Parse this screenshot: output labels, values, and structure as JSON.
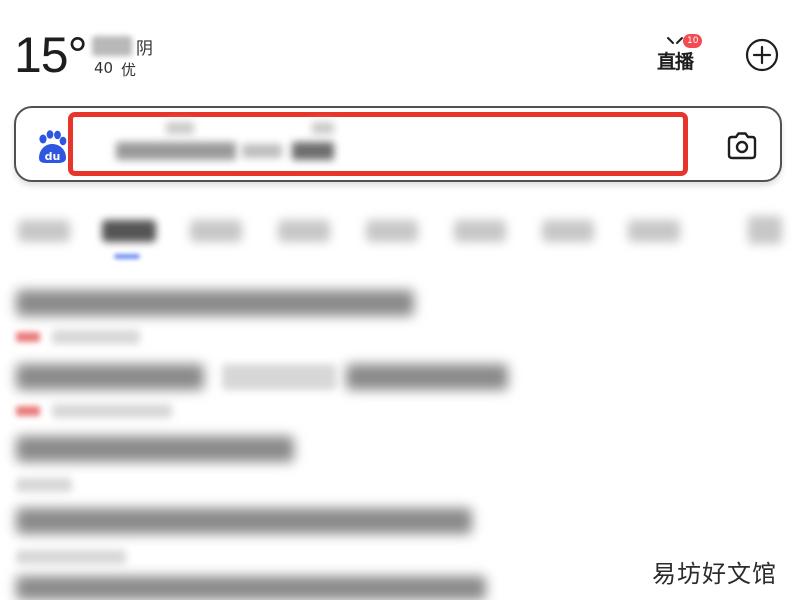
{
  "header": {
    "temperature": "15°",
    "weather": "阴",
    "aqi_value": "40",
    "aqi_level": "优",
    "live_label": "直播",
    "live_badge": "10"
  },
  "search": {
    "placeholder": ""
  },
  "colors": {
    "highlight_border": "#e8352b",
    "baidu_blue": "#2f56e0",
    "live_badge": "#f44a52",
    "tab_indicator": "#6f8ff2"
  },
  "icons": {
    "logo": "baidu-paw-logo",
    "add": "plus-circle-icon",
    "camera": "camera-icon",
    "live": "tv-live-icon"
  },
  "watermark": "易坊好文馆"
}
